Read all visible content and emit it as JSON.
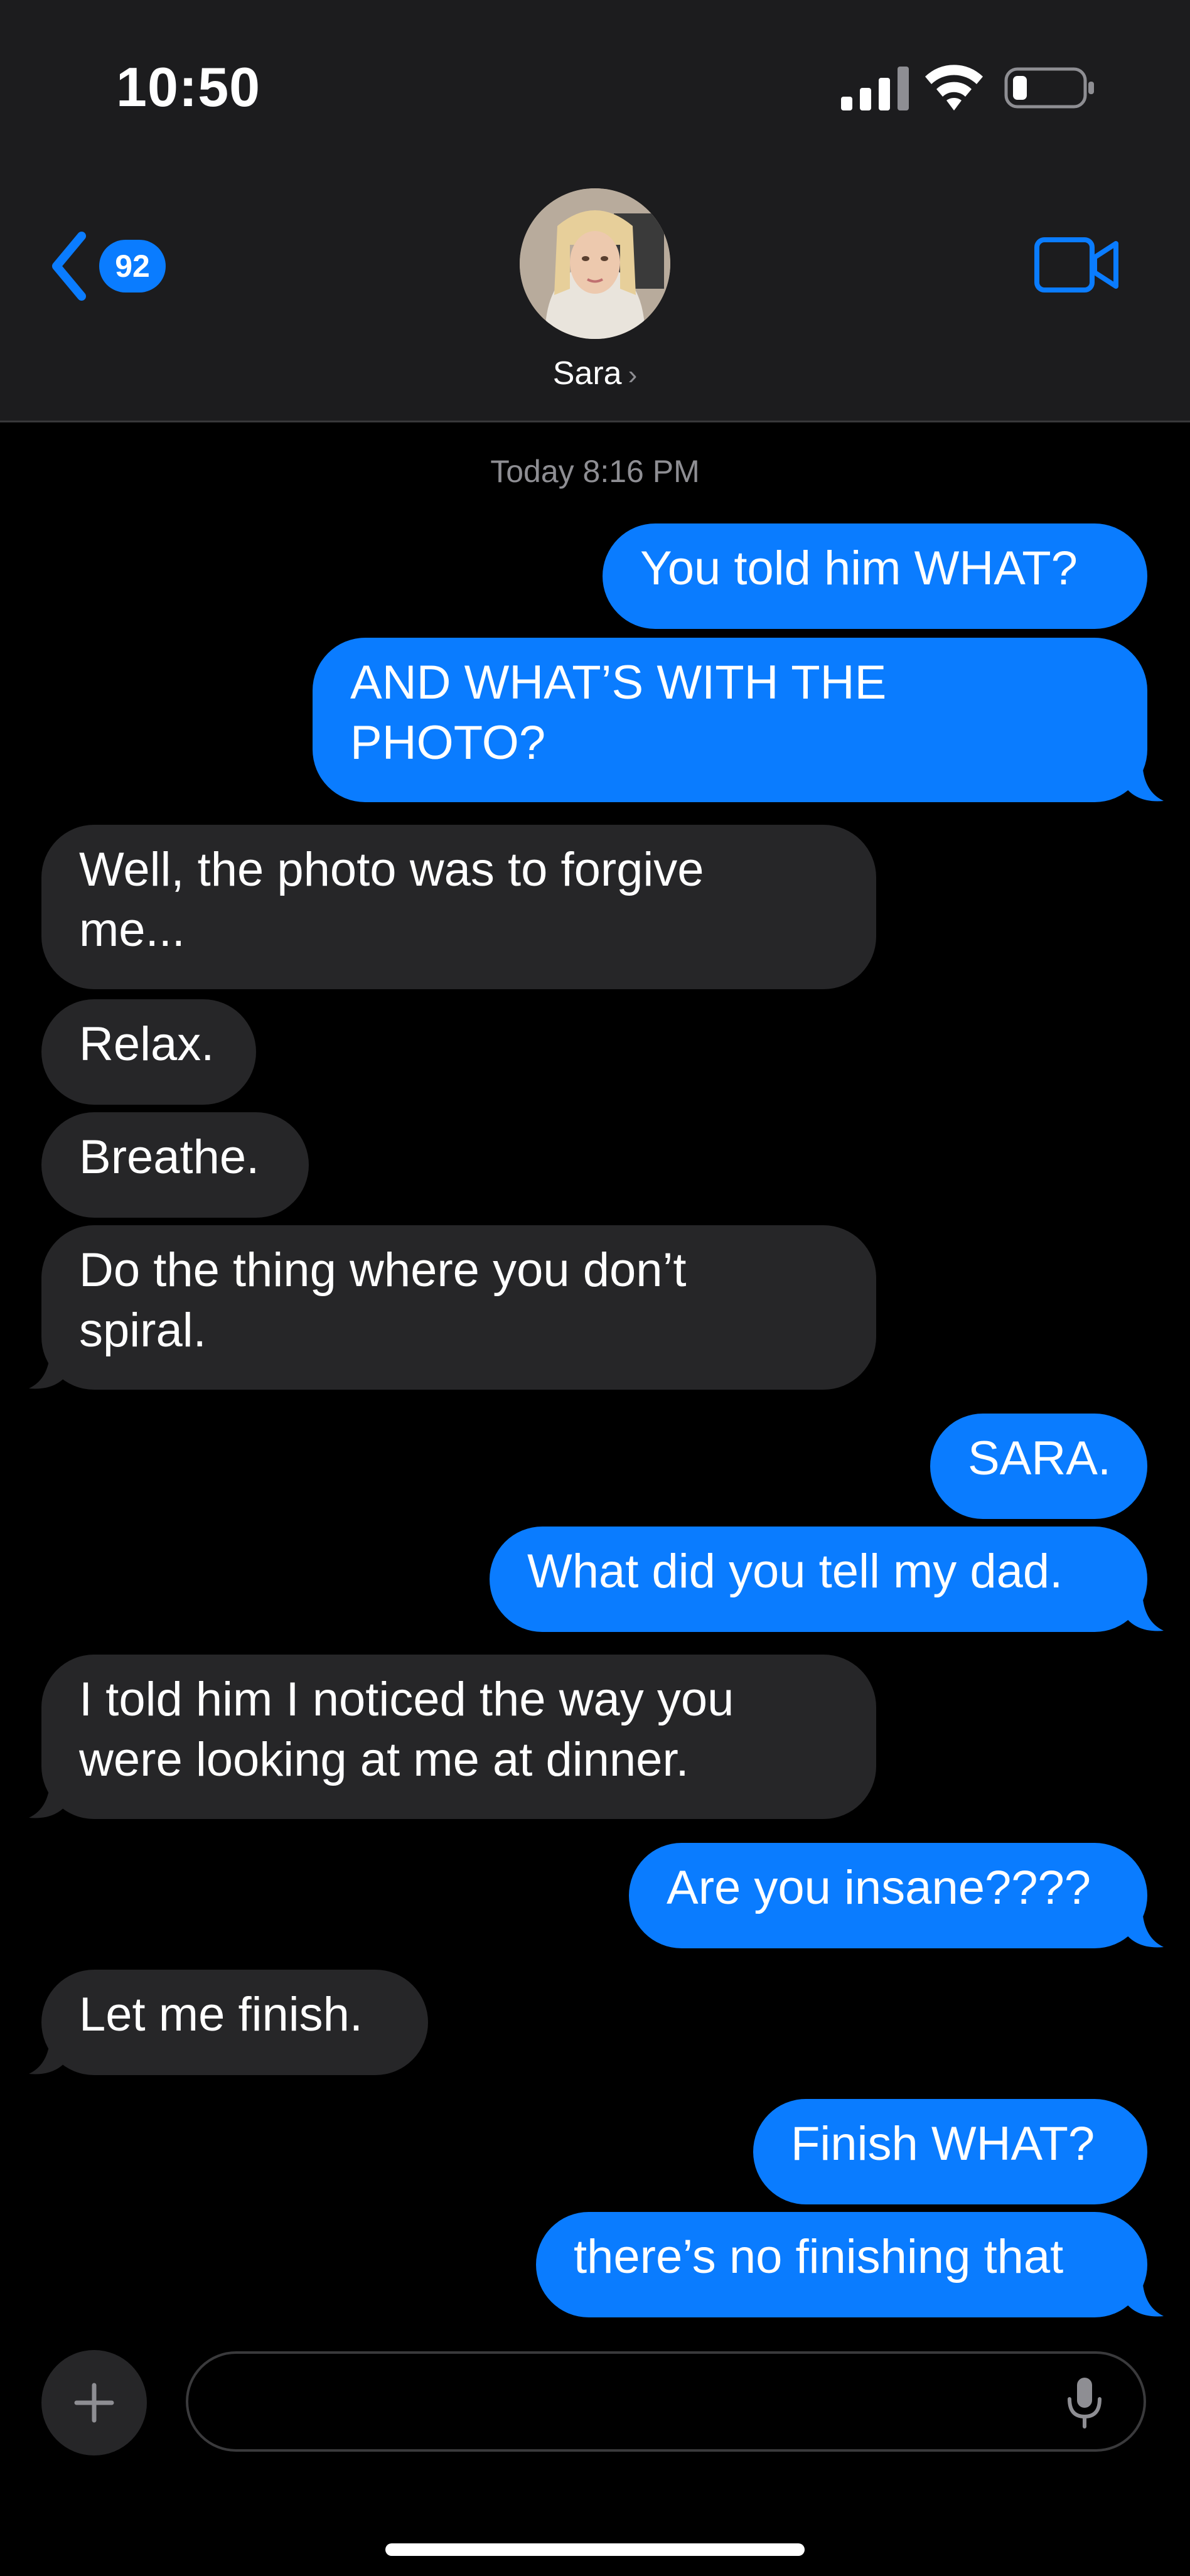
{
  "status_bar": {
    "time": "10:50",
    "battery_level": 0.2
  },
  "header": {
    "back_count": "92",
    "contact_name": "Sara",
    "avatar_icon": "contact-photo"
  },
  "conversation": {
    "timestamp": "Today 8:16 PM",
    "messages": [
      {
        "from": "me",
        "text": "You told him WHAT?"
      },
      {
        "from": "me",
        "text": "AND WHAT’S WITH THE",
        "text2": "PHOTO?"
      },
      {
        "from": "them",
        "text": "Well, the photo was to forgive",
        "text2": "me..."
      },
      {
        "from": "them",
        "text": "Relax."
      },
      {
        "from": "them",
        "text": "Breathe."
      },
      {
        "from": "them",
        "text": "Do the thing where you don’t",
        "text2": "spiral."
      },
      {
        "from": "me",
        "text": "SARA."
      },
      {
        "from": "me",
        "text": "What did you tell my dad."
      },
      {
        "from": "them",
        "text": "I told him I noticed the way you",
        "text2": "were looking at me at dinner."
      },
      {
        "from": "me",
        "text": "Are you insane????"
      },
      {
        "from": "them",
        "text": "Let me finish."
      },
      {
        "from": "me",
        "text": "Finish WHAT?"
      },
      {
        "from": "me",
        "text": "there’s no finishing that"
      }
    ]
  },
  "composer": {
    "plus_icon": "plus-icon",
    "mic_icon": "microphone-icon"
  },
  "colors": {
    "sent": "#0a7cff",
    "received": "#262628",
    "background": "#000000",
    "header": "#1c1c1e"
  }
}
